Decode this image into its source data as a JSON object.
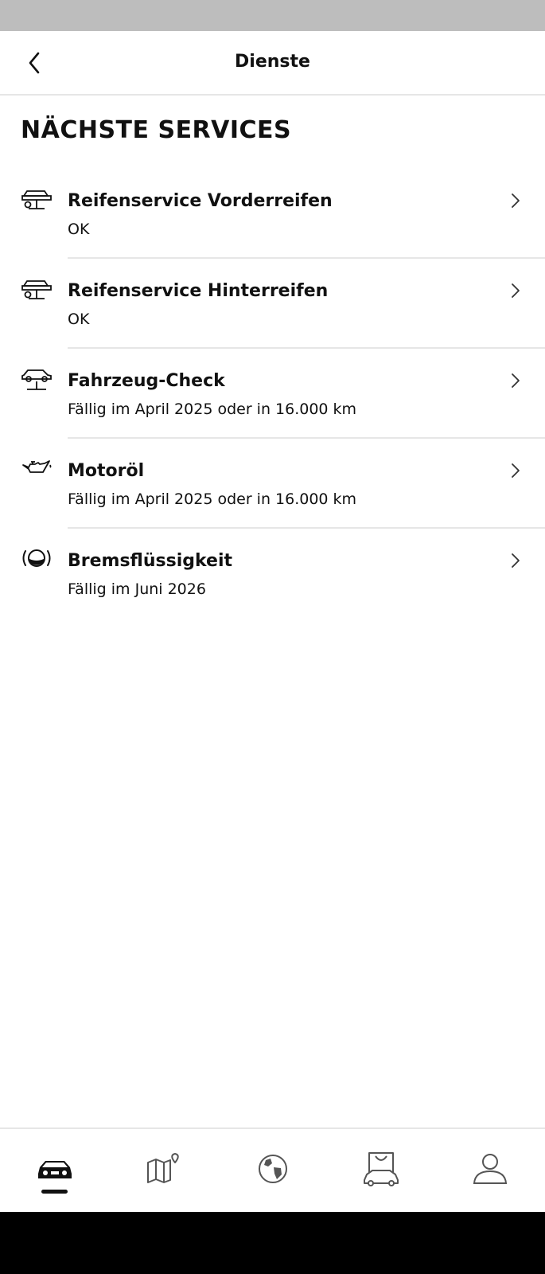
{
  "header": {
    "title": "Dienste",
    "back_icon": "chevron-left-icon"
  },
  "section": {
    "title": "NÄCHSTE SERVICES"
  },
  "services": [
    {
      "icon": "tire-lift-icon",
      "title": "Reifenservice Vorderreifen",
      "status": "OK"
    },
    {
      "icon": "tire-lift-icon",
      "title": "Reifenservice Hinterreifen",
      "status": "OK"
    },
    {
      "icon": "vehicle-lift-icon",
      "title": "Fahrzeug-Check",
      "status": "Fällig im April 2025 oder in 16.000 km"
    },
    {
      "icon": "oil-can-icon",
      "title": "Motoröl",
      "status": "Fällig im April 2025 oder in 16.000 km"
    },
    {
      "icon": "brake-fluid-icon",
      "title": "Bremsflüssigkeit",
      "status": "Fällig im Juni 2026"
    }
  ],
  "bottom_nav": {
    "items": [
      "car-icon",
      "map-icon",
      "globe-icon",
      "shop-icon",
      "profile-icon"
    ],
    "active": "car-icon"
  },
  "colors": {
    "status_bar": "#bdbdbd",
    "divider": "#e6e6e6",
    "text": "#111111",
    "system_bar": "#000000"
  }
}
